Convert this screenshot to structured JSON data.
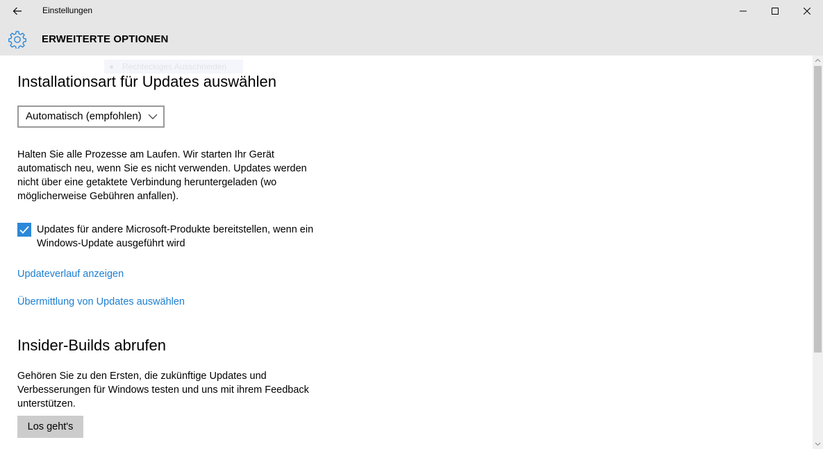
{
  "window": {
    "app_title": "Einstellungen",
    "back_icon": "arrow-left-icon",
    "minimize_icon": "minimize-icon",
    "maximize_icon": "maximize-icon",
    "close_icon": "close-icon"
  },
  "header": {
    "icon": "gear-icon",
    "title": "ERWEITERTE OPTIONEN",
    "accent_color": "#2b88d8"
  },
  "ghost_tooltip": {
    "label": "Rechteckiges Ausschneiden"
  },
  "install_section": {
    "heading": "Installationsart für Updates auswählen",
    "dropdown_value": "Automatisch (empfohlen)",
    "description": "Halten Sie alle Prozesse am Laufen. Wir starten Ihr Gerät automatisch neu, wenn Sie es nicht verwenden. Updates werden nicht über eine getaktete Verbindung heruntergeladen (wo möglicherweise Gebühren anfallen).",
    "checkbox_label": "Updates für andere Microsoft-Produkte bereitstellen, wenn ein Windows-Update ausgeführt wird",
    "checkbox_checked": true
  },
  "links": {
    "history": "Updateverlauf anzeigen",
    "delivery": "Übermittlung von Updates auswählen",
    "color": "#1c7fd1"
  },
  "insider_section": {
    "heading": "Insider-Builds abrufen",
    "description": "Gehören Sie zu den Ersten, die zukünftige Updates und Verbesserungen für Windows testen und uns mit ihrem Feedback unterstützen.",
    "button_label": "Los geht's"
  }
}
